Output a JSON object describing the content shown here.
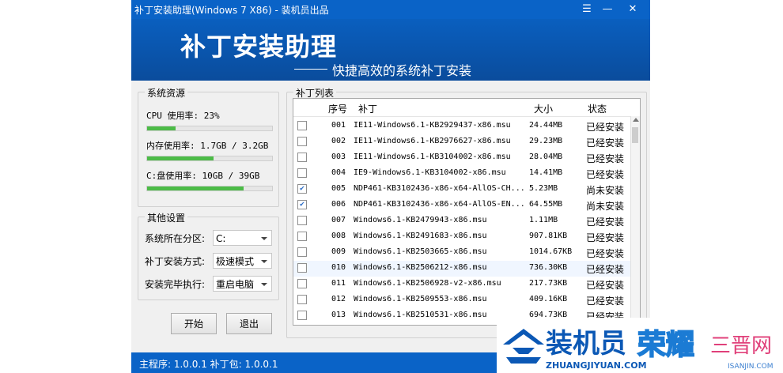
{
  "window": {
    "title": "补丁安装助理(Windows 7 X86) - 装机员出品",
    "banner_title": "补丁安装助理",
    "banner_subtitle": "快捷高效的系统补丁安装"
  },
  "resources": {
    "group_title": "系统资源",
    "cpu_label": "CPU 使用率: 23%",
    "cpu_usage": 0.23,
    "mem_label": "内存使用率: 1.7GB / 3.2GB",
    "mem_usage": 0.53,
    "disk_label": "C:盘使用率: 10GB / 39GB",
    "disk_usage": 0.77
  },
  "settings": {
    "group_title": "其他设置",
    "partition_label": "系统所在分区:",
    "partition_value": "C:",
    "mode_label": "补丁安装方式:",
    "mode_value": "极速模式",
    "after_label": "安装完毕执行:",
    "after_value": "重启电脑"
  },
  "buttons": {
    "start": "开始",
    "exit": "退出"
  },
  "patch_list": {
    "group_title": "补丁列表",
    "columns": {
      "seq": "序号",
      "patch": "补丁",
      "size": "大小",
      "status": "状态"
    },
    "rows": [
      {
        "seq": "001",
        "name": "IE11-Windows6.1-KB2929437-x86.msu",
        "size": "24.44MB",
        "status": "已经安装",
        "checked": false
      },
      {
        "seq": "002",
        "name": "IE11-Windows6.1-KB2976627-x86.msu",
        "size": "29.23MB",
        "status": "已经安装",
        "checked": false
      },
      {
        "seq": "003",
        "name": "IE11-Windows6.1-KB3104002-x86.msu",
        "size": "28.04MB",
        "status": "已经安装",
        "checked": false
      },
      {
        "seq": "004",
        "name": "IE9-Windows6.1-KB3104002-x86.msu",
        "size": "14.41MB",
        "status": "已经安装",
        "checked": false
      },
      {
        "seq": "005",
        "name": "NDP461-KB3102436-x86-x64-AllOS-CH...",
        "size": "5.23MB",
        "status": "尚未安装",
        "checked": true
      },
      {
        "seq": "006",
        "name": "NDP461-KB3102436-x86-x64-AllOS-EN...",
        "size": "64.55MB",
        "status": "尚未安装",
        "checked": true
      },
      {
        "seq": "007",
        "name": "Windows6.1-KB2479943-x86.msu",
        "size": "1.11MB",
        "status": "已经安装",
        "checked": false
      },
      {
        "seq": "008",
        "name": "Windows6.1-KB2491683-x86.msu",
        "size": "907.81KB",
        "status": "已经安装",
        "checked": false
      },
      {
        "seq": "009",
        "name": "Windows6.1-KB2503665-x86.msu",
        "size": "1014.67KB",
        "status": "已经安装",
        "checked": false
      },
      {
        "seq": "010",
        "name": "Windows6.1-KB2506212-x86.msu",
        "size": "736.30KB",
        "status": "已经安装",
        "checked": false
      },
      {
        "seq": "011",
        "name": "Windows6.1-KB2506928-v2-x86.msu",
        "size": "217.73KB",
        "status": "已经安装",
        "checked": false
      },
      {
        "seq": "012",
        "name": "Windows6.1-KB2509553-x86.msu",
        "size": "409.16KB",
        "status": "已经安装",
        "checked": false
      },
      {
        "seq": "013",
        "name": "Windows6.1-KB2510531-x86.msu",
        "size": "694.73KB",
        "status": "已经安装",
        "checked": false
      }
    ]
  },
  "status_bar": "主程序: 1.0.0.1 补丁包: 1.0.0.1",
  "watermark": {
    "brand": "装机员",
    "brand_url": "ZHUANGJIYUAN.COM",
    "brand2": "荣耀",
    "brand3": "三晋网",
    "brand3_url": "ISANJIN.COM"
  },
  "colors": {
    "title_blue": "#0a63c7",
    "progress_green": "#4cbb47"
  }
}
